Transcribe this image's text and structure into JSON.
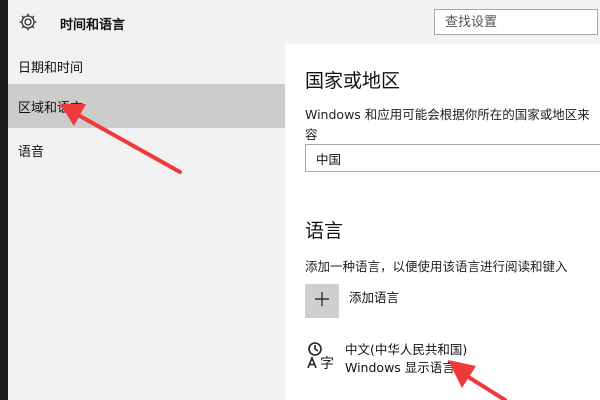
{
  "header": {
    "title": "时间和语言",
    "search_placeholder": "查找设置",
    "icon": "gear-icon"
  },
  "sidebar": {
    "items": [
      {
        "label": "日期和时间",
        "active": false
      },
      {
        "label": "区域和语言",
        "active": true
      },
      {
        "label": "语音",
        "active": false
      }
    ]
  },
  "region": {
    "heading": "国家或地区",
    "description_line1": "Windows 和应用可能会根据你所在的国家或地区来",
    "description_line2": "容",
    "selected_country": "中国"
  },
  "language": {
    "heading": "语言",
    "description": "添加一种语言，以便使用该语言进行阅读和键入",
    "add_label": "添加语言",
    "installed": [
      {
        "name": "中文(中华人民共和国)",
        "subtitle": "Windows 显示语言",
        "icon": "language-icon"
      }
    ]
  },
  "colors": {
    "accent_arrow": "#ee3a3a",
    "sidebar_bg": "#f2f2f2",
    "selected_bg": "#cccccc"
  }
}
